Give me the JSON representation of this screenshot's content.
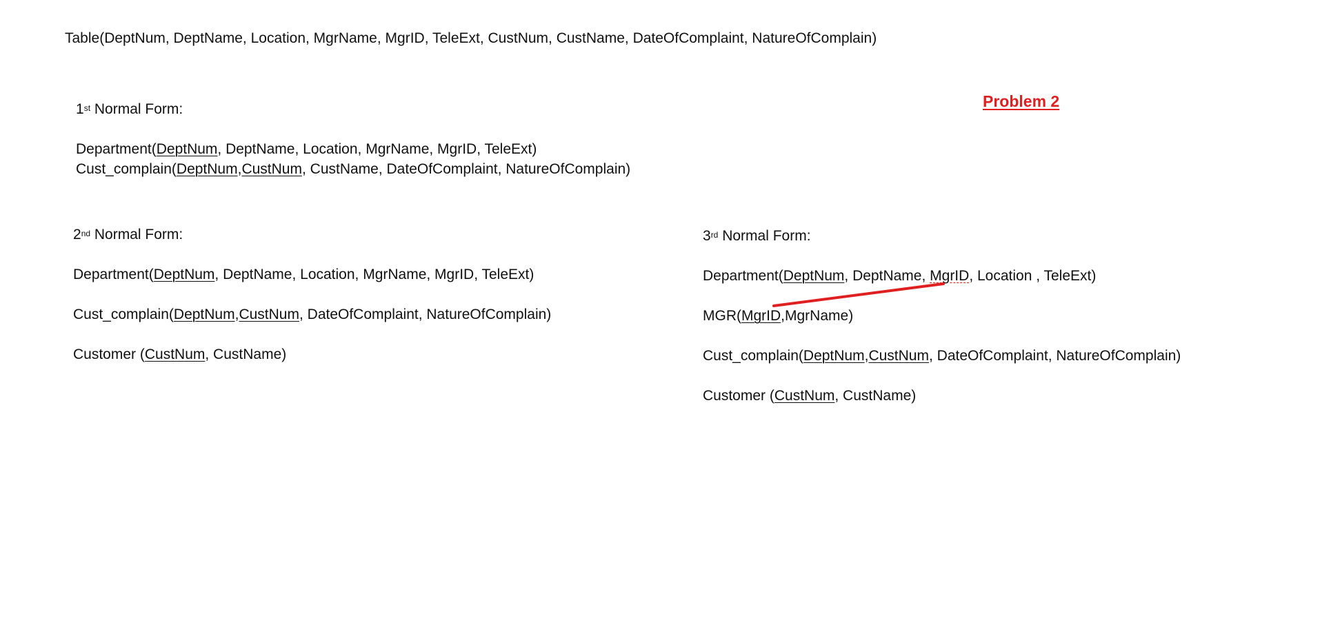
{
  "table_line": "Table(DeptNum, DeptName, Location, MgrName, MgrID, TeleExt, CustNum, CustName, DateOfComplaint, NatureOfComplain)",
  "problem_label": "Problem 2",
  "nf1": {
    "num": "1",
    "sup": "st",
    "title": " Normal Form:",
    "department": {
      "prefix": "Department(",
      "key": "DeptNum",
      "rest": ", DeptName, Location, MgrName, MgrID, TeleExt)"
    },
    "cust_complain": {
      "prefix": "Cust_complain(",
      "key1": "DeptNum",
      "sep": ",",
      "key2": "CustNum",
      "rest": ", CustName, DateOfComplaint, NatureOfComplain)"
    }
  },
  "nf2": {
    "num": "2",
    "sup": "nd",
    "title": " Normal Form:",
    "department": {
      "prefix": "Department(",
      "key": "DeptNum",
      "rest": ", DeptName, Location, MgrName, MgrID, TeleExt)"
    },
    "cust_complain": {
      "prefix": "Cust_complain(",
      "key1": "DeptNum",
      "sep": ",",
      "key2": "CustNum",
      "rest": ", DateOfComplaint, NatureOfComplain)"
    },
    "customer": {
      "prefix": "Customer (",
      "key": "CustNum",
      "rest": ", CustName)"
    }
  },
  "nf3": {
    "num": "3",
    "sup": "rd",
    "title": " Normal Form:",
    "department": {
      "prefix": "Department(",
      "key": "DeptNum",
      "mid": ", DeptName, ",
      "fk": "MgrID",
      "rest": ", Location , TeleExt)"
    },
    "mgr": {
      "prefix": "MGR(",
      "key": "MgrID",
      "rest": ",MgrName)"
    },
    "cust_complain": {
      "prefix": "Cust_complain(",
      "key1": "DeptNum",
      "sep": ",",
      "key2": "CustNum",
      "rest": ", DateOfComplaint, NatureOfComplain)"
    },
    "customer": {
      "prefix": "Customer (",
      "key": "CustNum",
      "rest": ", CustName)"
    }
  },
  "colors": {
    "text": "#111111",
    "annotation": "#e02020"
  }
}
